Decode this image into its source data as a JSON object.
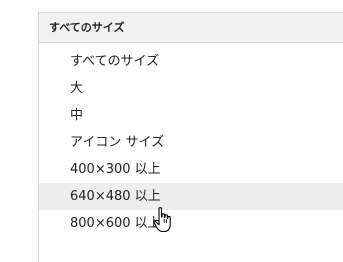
{
  "menu": {
    "header": "すべてのサイズ",
    "items": [
      {
        "label": "すべてのサイズ"
      },
      {
        "label": "大"
      },
      {
        "label": "中"
      },
      {
        "label": "アイコン サイズ"
      },
      {
        "label": "400×300 以上"
      },
      {
        "label": "640×480 以上"
      },
      {
        "label": "800×600 以上"
      }
    ],
    "hovered_index": 5
  },
  "cursor": {
    "icon": "hand-pointer-icon"
  },
  "colors": {
    "header_bg": "#f1f1f1",
    "hover_bg": "#eeeeee",
    "border": "#d6d6d6",
    "text": "#222222"
  }
}
